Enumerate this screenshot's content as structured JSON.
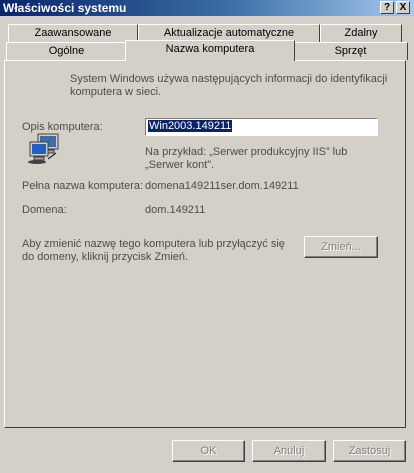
{
  "window": {
    "title": "Właściwości systemu"
  },
  "title_buttons": {
    "help": "?",
    "close": "X"
  },
  "tabs_row1": [
    "Zaawansowane",
    "Aktualizacje automatyczne",
    "Zdalny"
  ],
  "tabs_row2": [
    "Ogólne",
    "Nazwa komputera",
    "Sprzęt"
  ],
  "active_tab": "Nazwa komputera",
  "info": {
    "line1": "System Windows używa następujących informacji do identyfikacji",
    "line2": "komputera w sieci."
  },
  "description": {
    "label": "Opis komputera:",
    "value": "Win2003.149211",
    "example_line1": "Na przykład: „Serwer produkcyjny IIS” lub",
    "example_line2": "„Serwer kont”."
  },
  "full_name": {
    "label": "Pełna nazwa komputera:",
    "value": "domena149211ser.dom.149211"
  },
  "domain": {
    "label": "Domena:",
    "value": "dom.149211"
  },
  "change": {
    "text_line1": "Aby zmienić nazwę tego komputera lub przyłączyć się",
    "text_line2": "do domeny, kliknij przycisk Zmień.",
    "button": "Zmień..."
  },
  "footer": {
    "ok": "OK",
    "cancel": "Anuluj",
    "apply": "Zastosuj"
  }
}
